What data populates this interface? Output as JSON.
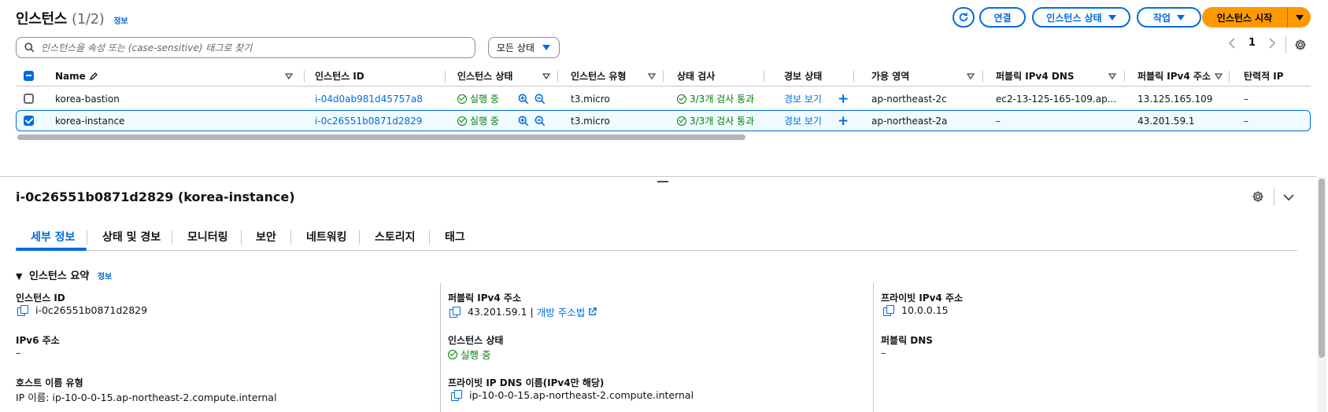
{
  "header": {
    "title": "인스턴스",
    "count": "(1/2)",
    "info_link": "정보",
    "connect_label": "연결",
    "instance_state_label": "인스턴스 상태",
    "actions_label": "작업",
    "launch_label": "인스턴스 시작"
  },
  "search": {
    "placeholder": "인스턴스을 속성 또는 (case-sensitive) 태그로 찾기"
  },
  "filter": {
    "selected": "모든 상태"
  },
  "pagination": {
    "page": "1"
  },
  "table": {
    "columns": [
      "Name",
      "인스턴스 ID",
      "인스턴스 상태",
      "인스턴스 유형",
      "상태 검사",
      "경보 상태",
      "가용 영역",
      "퍼블릭 IPv4 DNS",
      "퍼블릭 IPv4 주소",
      "탄력적 IP"
    ],
    "rows": [
      {
        "name": "korea-bastion",
        "id": "i-04d0ab981d45757a8",
        "state": "실행 중",
        "type": "t3.micro",
        "checks": "3/3개 검사 통과",
        "alarm": "경보 보기",
        "az": "ap-northeast-2c",
        "dns": "ec2-13-125-165-109.ap...",
        "ip": "13.125.165.109",
        "eip": "–",
        "selected": false
      },
      {
        "name": "korea-instance",
        "id": "i-0c26551b0871d2829",
        "state": "실행 중",
        "type": "t3.micro",
        "checks": "3/3개 검사 통과",
        "alarm": "경보 보기",
        "az": "ap-northeast-2a",
        "dns": "–",
        "ip": "43.201.59.1",
        "eip": "–",
        "selected": true
      }
    ]
  },
  "detail": {
    "title": "i-0c26551b0871d2829 (korea-instance)",
    "tabs": [
      "세부 정보",
      "상태 및 경보",
      "모니터링",
      "보안",
      "네트워킹",
      "스토리지",
      "태그"
    ],
    "section_title": "인스턴스 요약",
    "section_info": "정보",
    "fields": {
      "instance_id_label": "인스턴스 ID",
      "instance_id_value": "i-0c26551b0871d2829",
      "public_ipv4_label": "퍼블릭 IPv4 주소",
      "public_ipv4_value": "43.201.59.1",
      "open_address_link": "개방 주소법",
      "private_ipv4_label": "프라이빗 IPv4 주소",
      "private_ipv4_value": "10.0.0.15",
      "ipv6_label": "IPv6 주소",
      "ipv6_value": "–",
      "instance_state_label": "인스턴스 상태",
      "instance_state_value": "실행 중",
      "public_dns_label": "퍼블릭 DNS",
      "public_dns_value": "–",
      "hostname_type_label": "호스트 이름 유형",
      "hostname_type_value": "IP 이름: ip-10-0-0-15.ap-northeast-2.compute.internal",
      "private_dns_label": "프라이빗 IP DNS 이름(IPv4만 해당)",
      "private_dns_value": "ip-10-0-0-15.ap-northeast-2.compute.internal"
    }
  },
  "colors": {
    "accent": "#006ce0",
    "primary": "#ff9900",
    "success": "#037f0c"
  }
}
